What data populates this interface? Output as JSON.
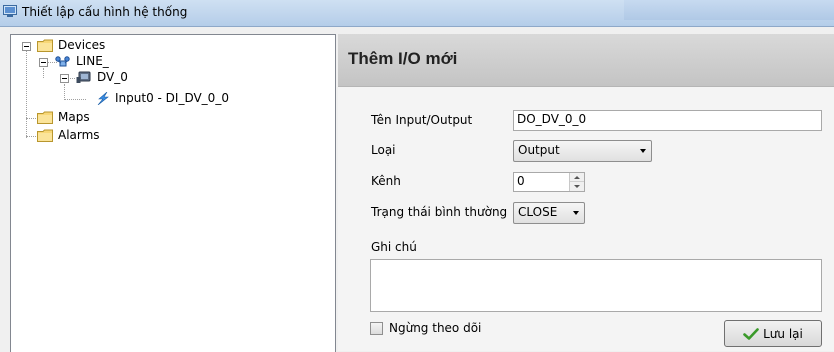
{
  "window": {
    "title": "Thiết lập cấu hình hệ thống"
  },
  "tree": {
    "devices": "Devices",
    "line": "LINE_",
    "device": "DV_0",
    "input": "Input0 - DI_DV_0_0",
    "maps": "Maps",
    "alarms": "Alarms"
  },
  "form": {
    "title": "Thêm I/O mới",
    "name_label": "Tên Input/Output",
    "name_value": "DO_DV_0_0",
    "type_label": "Loại",
    "type_value": "Output",
    "channel_label": "Kênh",
    "channel_value": "0",
    "normal_state_label": "Trạng thái bình thường",
    "normal_state_value": "CLOSE",
    "note_label": "Ghi chú",
    "note_value": "",
    "stop_monitor_label": "Ngừng theo dõi",
    "save_label": "Lưu lại"
  },
  "colors": {
    "header_bg": "#c8c8c8",
    "titlebar_bg": "#b9d1ea",
    "save_icon": "#3a9a2a"
  },
  "icons": [
    "app-icon",
    "folder-icon",
    "network-icon",
    "device-icon",
    "lightning-icon",
    "check-icon"
  ]
}
